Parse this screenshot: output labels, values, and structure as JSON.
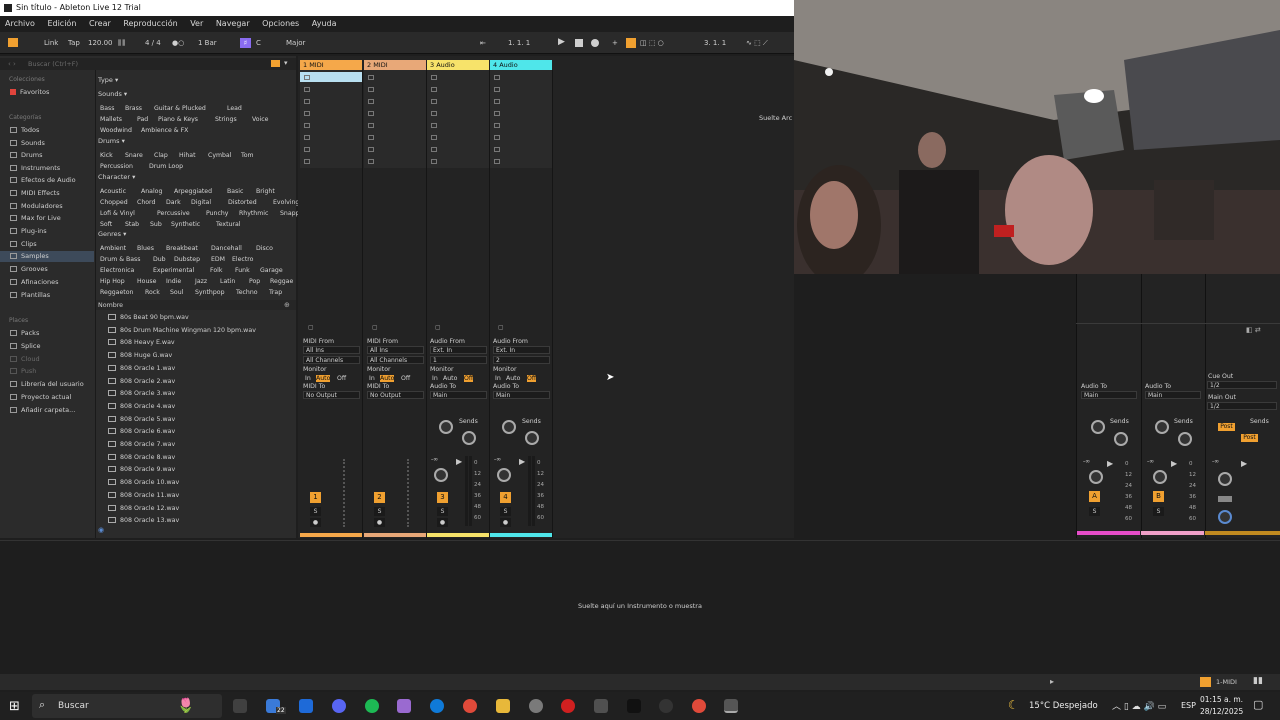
{
  "window": {
    "title": "Sin título - Ableton Live 12 Trial"
  },
  "menu": [
    "Archivo",
    "Edición",
    "Crear",
    "Reproducción",
    "Ver",
    "Navegar",
    "Opciones",
    "Ayuda"
  ],
  "control": {
    "link": "Link",
    "tap": "Tap",
    "tempo": "120.00",
    "signature": "4 / 4",
    "quantize": "1 Bar",
    "key": "C",
    "scale": "Major",
    "position": "1.   1.   1",
    "end": "3.   1.   1"
  },
  "browser": {
    "search_placeholder": "Buscar (Ctrl+F)",
    "collections_head": "Colecciones",
    "favorites": "Favoritos",
    "categories_head": "Categorías",
    "categories": [
      "Todos",
      "Sounds",
      "Drums",
      "Instruments",
      "Efectos de Audio",
      "MIDI Effects",
      "Moduladores",
      "Max for Live",
      "Plug-ins",
      "Clips",
      "Samples",
      "Grooves",
      "Afinaciones",
      "Plantillas"
    ],
    "places_head": "Places",
    "places": [
      "Packs",
      "Splice",
      "Cloud",
      "Push",
      "Librería del usuario",
      "Proyecto actual",
      "Añadir carpeta..."
    ],
    "type_head": "Type",
    "sounds_head": "Sounds",
    "sounds_row1": [
      "Bass",
      "Brass",
      "Guitar & Plucked",
      "Lead"
    ],
    "sounds_row2": [
      "Mallets",
      "Pad",
      "Piano & Keys",
      "Strings",
      "Voice"
    ],
    "sounds_row3": [
      "Woodwind",
      "Ambience & FX"
    ],
    "drums_head": "Drums",
    "drums_row1": [
      "Kick",
      "Snare",
      "Clap",
      "Hihat",
      "Cymbal",
      "Tom"
    ],
    "drums_row2": [
      "Percussion",
      "Drum Loop"
    ],
    "character_head": "Character",
    "character_row1": [
      "Acoustic",
      "Analog",
      "Arpeggiated",
      "Basic",
      "Bright"
    ],
    "character_row2": [
      "Chopped",
      "Chord",
      "Dark",
      "Digital",
      "Distorted",
      "Evolving"
    ],
    "character_row3": [
      "Lofi & Vinyl",
      "Percussive",
      "Punchy",
      "Rhythmic",
      "Snappy"
    ],
    "character_row4": [
      "Soft",
      "Stab",
      "Sub",
      "Synthetic",
      "Textural"
    ],
    "genres_head": "Genres",
    "genres_row1": [
      "Ambient",
      "Blues",
      "Breakbeat",
      "Dancehall",
      "Disco"
    ],
    "genres_row2": [
      "Drum & Bass",
      "Dub",
      "Dubstep",
      "EDM",
      "Electro"
    ],
    "genres_row3": [
      "Electronica",
      "Experimental",
      "Folk",
      "Funk",
      "Garage"
    ],
    "genres_row4": [
      "Hip Hop",
      "House",
      "Indie",
      "Jazz",
      "Latin",
      "Pop",
      "Reggae"
    ],
    "genres_row5": [
      "Reggaeton",
      "Rock",
      "Soul",
      "Synthpop",
      "Techno",
      "Trap"
    ],
    "name_head": "Nombre",
    "files": [
      "80s Beat 90 bpm.wav",
      "80s Drum Machine Wingman 120 bpm.wav",
      "808 Heavy E.wav",
      "808 Huge G.wav",
      "808 Oracle 1.wav",
      "808 Oracle 2.wav",
      "808 Oracle 3.wav",
      "808 Oracle 4.wav",
      "808 Oracle 5.wav",
      "808 Oracle 6.wav",
      "808 Oracle 7.wav",
      "808 Oracle 8.wav",
      "808 Oracle 9.wav",
      "808 Oracle 10.wav",
      "808 Oracle 11.wav",
      "808 Oracle 12.wav",
      "808 Oracle 13.wav"
    ]
  },
  "tracks": [
    {
      "name": "1 MIDI",
      "color": "#f5a84a",
      "from_label": "MIDI From",
      "from": "All Ins",
      "channel": "All Channels",
      "to_label": "MIDI To",
      "to": "No Output",
      "number": "1"
    },
    {
      "name": "2 MIDI",
      "color": "#e8a878",
      "from_label": "MIDI From",
      "from": "All Ins",
      "channel": "All Channels",
      "to_label": "MIDI To",
      "to": "No Output",
      "number": "2"
    },
    {
      "name": "3 Audio",
      "color": "#f7e36a",
      "from_label": "Audio From",
      "from": "Ext. In",
      "channel": "1",
      "to_label": "Audio To",
      "to": "Main",
      "number": "3"
    },
    {
      "name": "4 Audio",
      "color": "#4fe6ea",
      "from_label": "Audio From",
      "from": "Ext. In",
      "channel": "2",
      "to_label": "Audio To",
      "to": "Main",
      "number": "4"
    }
  ],
  "monitor": {
    "label": "Monitor",
    "in": "In",
    "auto": "Auto",
    "off": "Off"
  },
  "sends_label": "Sends",
  "solo_label": "S",
  "drop_files_hint": "Suelte Arc",
  "returns": [
    {
      "name": "A",
      "to_label": "Audio To",
      "to": "Main",
      "color": "#e64dc9"
    },
    {
      "name": "B",
      "to_label": "Audio To",
      "to": "Main",
      "color": "#f0a0c8"
    }
  ],
  "master": {
    "cue_label": "Cue Out",
    "cue": "1/2",
    "main_label": "Main Out",
    "main": "1/2",
    "post": "Post"
  },
  "meter_ticks": [
    "0",
    "12",
    "24",
    "36",
    "48",
    "60"
  ],
  "volume_readout": "-∞",
  "detail": {
    "hint": "Suelte aquí un Instrumento o muestra"
  },
  "status": {
    "track": "1-MIDI"
  },
  "taskbar": {
    "search": "Buscar",
    "badge": "22",
    "weather": "15°C  Despejado",
    "lang": "ESP",
    "time": "01:15 a. m.",
    "date": "28/12/2025"
  }
}
